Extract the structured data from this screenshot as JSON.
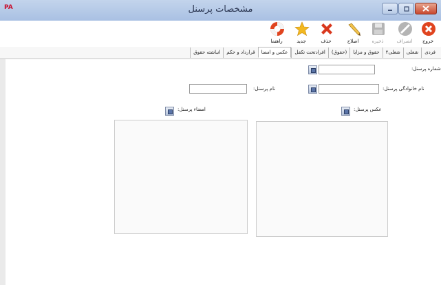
{
  "window": {
    "title": "مشخصات پرسنل",
    "app_badge": "PA"
  },
  "toolbar": {
    "exit": "خروج",
    "cancel": "انصراف",
    "save": "ذخیره",
    "edit": "اصلاح",
    "delete": "حذف",
    "new": "جدید",
    "help": "راهنما"
  },
  "tabs": [
    "فردی",
    "شغلی",
    "شغلی۲",
    "حقوق و مزایا",
    "(حقوق)",
    "افرادتحت تکفل",
    "عکس و امضا",
    "قرارداد و حکم",
    "انباشته حقوق"
  ],
  "active_tab": "عکس و امضا",
  "form": {
    "personnel_number_label": "شماره پرسنل:",
    "personnel_number_value": "",
    "last_name_label": "نام خانوادگی پرسنل:",
    "last_name_value": "",
    "first_name_label": "نام پرسنل:",
    "first_name_value": "",
    "photo_label": "عکس پرسنل:",
    "signature_label": "امضاء پرسنل:"
  },
  "colors": {
    "titlebar": "#b6c9e8",
    "close_button": "#c8482e",
    "exit_icon": "#e0441f",
    "delete_icon": "#d9381e",
    "new_icon": "#f2b820"
  }
}
